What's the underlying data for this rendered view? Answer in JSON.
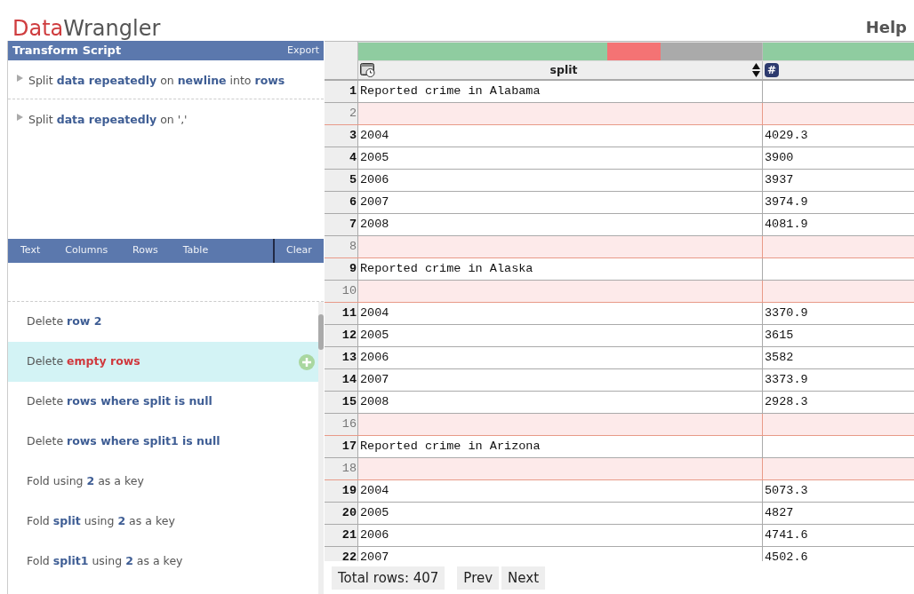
{
  "app": {
    "title": "**Data**Wrangler",
    "help": "Help"
  },
  "script_panel": {
    "title": "Transform Script",
    "export": "Export",
    "steps": [
      {
        "text": "Split **data repeatedly** on **newline** into **rows**"
      },
      {
        "text": "Split **data repeatedly** on ','"
      }
    ]
  },
  "tabs": [
    "Text",
    "Columns",
    "Rows",
    "Table"
  ],
  "clear": "Clear",
  "suggestions": [
    {
      "text": "Delete **row 2**",
      "selected": false
    },
    {
      "text": "Delete **empty rows**",
      "selected": true
    },
    {
      "text": "Delete **rows where split is null**",
      "selected": false
    },
    {
      "text": "Delete **rows where split1 is null**",
      "selected": false
    },
    {
      "text": "Fold using **2** as a key",
      "selected": false
    },
    {
      "text": "Fold **split** using **2** as a key",
      "selected": false
    },
    {
      "text": "Fold **split1** using **2** as a key",
      "selected": false
    }
  ],
  "table": {
    "columns": [
      {
        "kind": "date",
        "name": "split"
      },
      {
        "kind": "number",
        "type_label": "#"
      }
    ],
    "rows": [
      {
        "number": "1",
        "highlighted": false,
        "split": "Reported crime in Alabama"
      },
      {
        "number": "2",
        "highlighted": true
      },
      {
        "number": "3",
        "highlighted": false,
        "split": "2004",
        "column_2": "4029.3"
      },
      {
        "number": "4",
        "highlighted": false,
        "split": "2005",
        "column_2": "3900"
      },
      {
        "number": "5",
        "highlighted": false,
        "split": "2006",
        "column_2": "3937"
      },
      {
        "number": "6",
        "highlighted": false,
        "split": "2007",
        "column_2": "3974.9"
      },
      {
        "number": "7",
        "highlighted": false,
        "split": "2008",
        "column_2": "4081.9"
      },
      {
        "number": "8",
        "highlighted": true
      },
      {
        "number": "9",
        "highlighted": false,
        "split": "Reported crime in Alaska"
      },
      {
        "number": "10",
        "highlighted": true
      },
      {
        "number": "11",
        "highlighted": false,
        "split": "2004",
        "column_2": "3370.9"
      },
      {
        "number": "12",
        "highlighted": false,
        "split": "2005",
        "column_2": "3615"
      },
      {
        "number": "13",
        "highlighted": false,
        "split": "2006",
        "column_2": "3582"
      },
      {
        "number": "14",
        "highlighted": false,
        "split": "2007",
        "column_2": "3373.9"
      },
      {
        "number": "15",
        "highlighted": false,
        "split": "2008",
        "column_2": "2928.3"
      },
      {
        "number": "16",
        "highlighted": true
      },
      {
        "number": "17",
        "highlighted": false,
        "split": "Reported crime in Arizona"
      },
      {
        "number": "18",
        "highlighted": true
      },
      {
        "number": "19",
        "highlighted": false,
        "split": "2004",
        "column_2": "5073.3"
      },
      {
        "number": "20",
        "highlighted": false,
        "split": "2005",
        "column_2": "4827"
      },
      {
        "number": "21",
        "highlighted": false,
        "split": "2006",
        "column_2": "4741.6"
      },
      {
        "number": "22",
        "highlighted": false,
        "split": "2007",
        "column_2": "4502.6"
      }
    ]
  },
  "footer": {
    "total": "Total rows: 407",
    "prev": "Prev",
    "next": "Next"
  }
}
